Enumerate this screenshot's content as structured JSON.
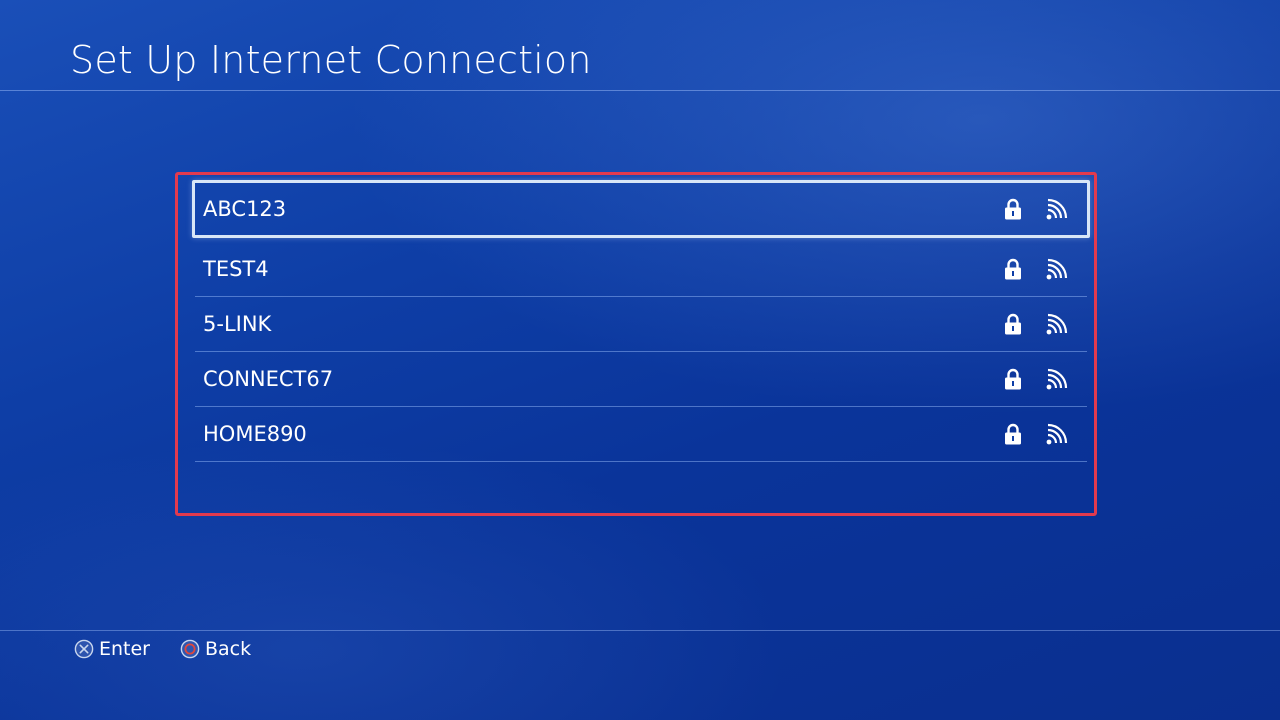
{
  "page": {
    "title": "Set Up Internet Connection"
  },
  "networks": [
    {
      "ssid": "ABC123",
      "secured": true,
      "signal_icon": "wifi-signal-icon",
      "selected": true
    },
    {
      "ssid": "TEST4",
      "secured": true,
      "signal_icon": "wifi-signal-icon",
      "selected": false
    },
    {
      "ssid": "5-LINK",
      "secured": true,
      "signal_icon": "wifi-signal-icon",
      "selected": false
    },
    {
      "ssid": "CONNECT67",
      "secured": true,
      "signal_icon": "wifi-signal-icon",
      "selected": false
    },
    {
      "ssid": "HOME890",
      "secured": true,
      "signal_icon": "wifi-signal-icon",
      "selected": false
    }
  ],
  "footer": {
    "enter_icon": "cross-button-icon",
    "enter_label": "Enter",
    "back_icon": "circle-button-icon",
    "back_label": "Back"
  },
  "colors": {
    "background": "#0e3ea6",
    "highlight_border": "#e23a4e",
    "selection_border": "#d8e6f7",
    "circle_button": "#e0463c"
  }
}
